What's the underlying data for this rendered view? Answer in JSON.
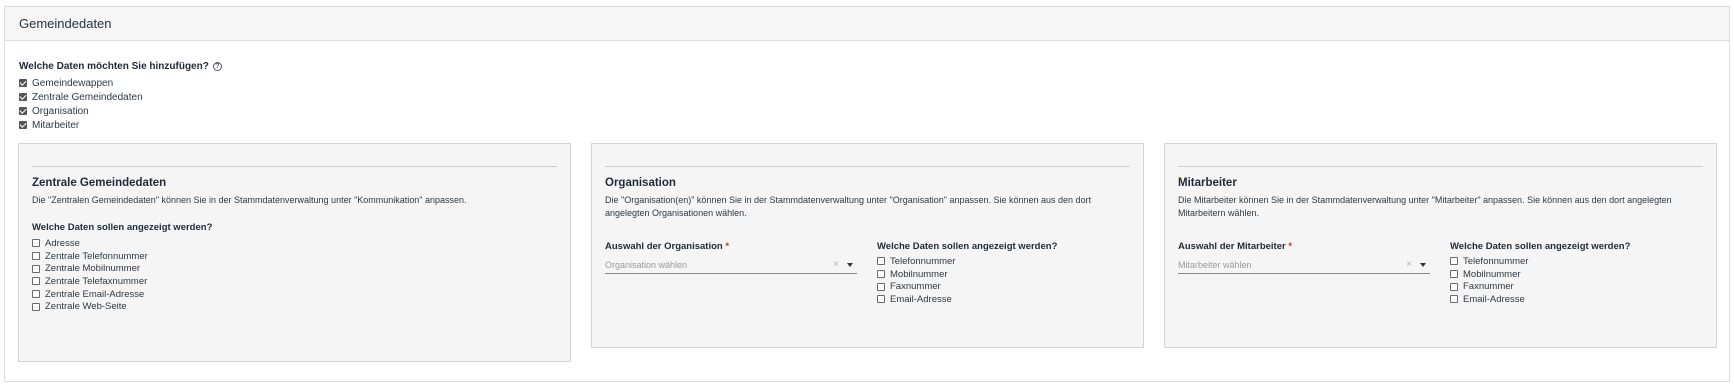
{
  "panel": {
    "title": "Gemeindedaten"
  },
  "question": "Welche Daten möchten Sie hinzufügen?",
  "top_options": [
    {
      "label": "Gemeindewappen",
      "checked": true
    },
    {
      "label": "Zentrale Gemeindedaten",
      "checked": true
    },
    {
      "label": "Organisation",
      "checked": true
    },
    {
      "label": "Mitarbeiter",
      "checked": true
    }
  ],
  "cards": {
    "zentrale": {
      "title": "Zentrale Gemeindedaten",
      "description": "Die \"Zentralen Gemeindedaten\" können Sie in der Stammdatenverwaltung unter \"Kommunikation\" anpassen.",
      "question": "Welche Daten sollen angezeigt werden?",
      "options": [
        {
          "label": "Adresse",
          "checked": false
        },
        {
          "label": "Zentrale Telefonnummer",
          "checked": false
        },
        {
          "label": "Zentrale Mobilnummer",
          "checked": false
        },
        {
          "label": "Zentrale Telefaxnummer",
          "checked": false
        },
        {
          "label": "Zentrale Email-Adresse",
          "checked": false
        },
        {
          "label": "Zentrale Web-Seite",
          "checked": false
        }
      ]
    },
    "organisation": {
      "title": "Organisation",
      "description": "Die \"Organisation(en)\" können Sie in der Stammdatenverwaltung unter \"Organisation\" anpassen. Sie können aus den dort angelegten Organisationen wählen.",
      "select_label": "Auswahl der Organisation",
      "required_mark": "*",
      "select_placeholder": "Organisation wählen",
      "clear_glyph": "×",
      "question": "Welche Daten sollen angezeigt werden?",
      "options": [
        {
          "label": "Telefonnummer",
          "checked": false
        },
        {
          "label": "Mobilnummer",
          "checked": false
        },
        {
          "label": "Faxnummer",
          "checked": false
        },
        {
          "label": "Email-Adresse",
          "checked": false
        }
      ]
    },
    "mitarbeiter": {
      "title": "Mitarbeiter",
      "description": "Die Mitarbeiter können Sie in der Stammdatenverwaltung unter \"Mitarbeiter\" anpassen. Sie können aus den dort angelegten Mitarbeitern wählen.",
      "select_label": "Auswahl der Mitarbeiter",
      "required_mark": "*",
      "select_placeholder": "Mitarbeiter wählen",
      "clear_glyph": "×",
      "question": "Welche Daten sollen angezeigt werden?",
      "options": [
        {
          "label": "Telefonnummer",
          "checked": false
        },
        {
          "label": "Mobilnummer",
          "checked": false
        },
        {
          "label": "Faxnummer",
          "checked": false
        },
        {
          "label": "Email-Adresse",
          "checked": false
        }
      ]
    }
  },
  "icons": {
    "help": "question-circle-icon",
    "checkbox": "checkbox-icon",
    "clear": "clear-icon",
    "dropdown": "chevron-down-icon"
  }
}
